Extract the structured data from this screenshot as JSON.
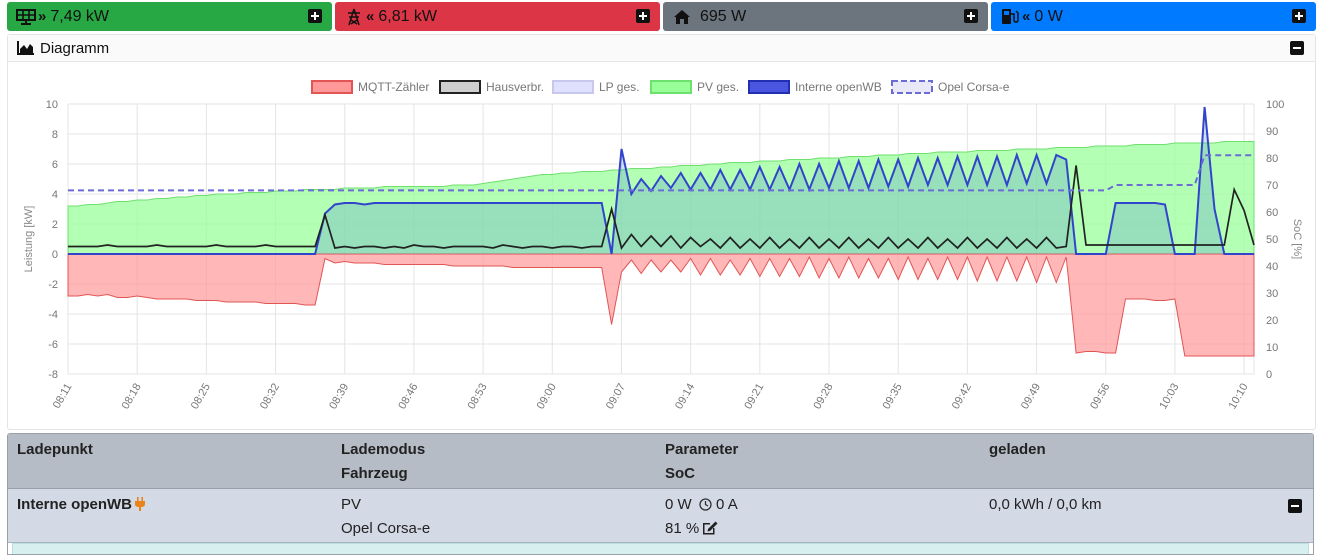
{
  "tiles": [
    {
      "name": "pv",
      "icon": "solar-panel-icon",
      "arrows": "»",
      "value": "7,49 kW",
      "color": "#28a745"
    },
    {
      "name": "grid",
      "icon": "power-pylon-icon",
      "arrows": "«",
      "value": "6,81 kW",
      "color": "#dc3545"
    },
    {
      "name": "house",
      "icon": "home-icon",
      "arrows": "",
      "value": "695 W",
      "color": "#6c757d"
    },
    {
      "name": "charging",
      "icon": "charging-station-icon",
      "arrows": "«",
      "value": "0 W",
      "color": "#007bff"
    }
  ],
  "diagram": {
    "title": "Diagramm"
  },
  "chart_data": {
    "type": "line",
    "legend": [
      "MQTT-Zähler",
      "Hausverbr.",
      "LP ges.",
      "PV ges.",
      "Interne openWB",
      "Opel Corsa-e"
    ],
    "legend_placement": "top",
    "ylabel": "Leistung [kW]",
    "y2label": "SoC [%]",
    "ylim": [
      -8,
      10
    ],
    "y2lim": [
      0,
      100
    ],
    "yticks": [
      -8,
      -6,
      -4,
      -2,
      0,
      2,
      4,
      6,
      8,
      10
    ],
    "y2ticks": [
      0,
      10,
      20,
      30,
      40,
      50,
      60,
      70,
      80,
      90,
      100
    ],
    "xticks": [
      "08:11",
      "08:18",
      "08:25",
      "08:32",
      "08:39",
      "08:46",
      "08:53",
      "09:00",
      "09:07",
      "09:14",
      "09:21",
      "09:28",
      "09:35",
      "09:42",
      "09:49",
      "09:56",
      "10:03",
      "10:10"
    ],
    "grid": true,
    "colors": {
      "grid": "#ff9999",
      "house": "#222222",
      "lp": "#e0e0ff",
      "pv": "#99ff99",
      "wb": "#3344cc",
      "soc": "#6b6bd6"
    },
    "x_minutes": [
      0,
      1,
      2,
      3,
      4,
      5,
      6,
      7,
      8,
      9,
      10,
      11,
      12,
      13,
      14,
      15,
      16,
      17,
      18,
      19,
      20,
      21,
      22,
      23,
      24,
      25,
      26,
      27,
      28,
      29,
      30,
      31,
      32,
      33,
      34,
      35,
      36,
      37,
      38,
      39,
      40,
      41,
      42,
      43,
      44,
      45,
      46,
      47,
      48,
      49,
      50,
      51,
      52,
      53,
      54,
      55,
      56,
      57,
      58,
      59,
      60,
      61,
      62,
      63,
      64,
      65,
      66,
      67,
      68,
      69,
      70,
      71,
      72,
      73,
      74,
      75,
      76,
      77,
      78,
      79,
      80,
      81,
      82,
      83,
      84,
      85,
      86,
      87,
      88,
      89,
      90,
      91,
      92,
      93,
      94,
      95,
      96,
      97,
      98,
      99,
      100,
      101,
      102,
      103,
      104,
      105,
      106,
      107,
      108,
      109,
      110,
      111,
      112,
      113,
      114,
      115,
      116,
      117,
      118,
      119,
      120
    ],
    "series": [
      {
        "name": "MQTT-Zähler",
        "values": [
          -2.8,
          -2.8,
          -2.7,
          -2.8,
          -2.7,
          -2.9,
          -2.9,
          -2.8,
          -2.9,
          -3.0,
          -3.0,
          -3.0,
          -3.0,
          -3.1,
          -3.1,
          -3.1,
          -3.2,
          -3.2,
          -3.2,
          -3.2,
          -3.3,
          -3.3,
          -3.3,
          -3.3,
          -3.4,
          -3.4,
          -0.3,
          -0.6,
          -0.5,
          -0.6,
          -0.6,
          -0.6,
          -0.7,
          -0.7,
          -0.7,
          -0.7,
          -0.7,
          -0.7,
          -0.7,
          -0.8,
          -0.8,
          -0.8,
          -0.8,
          -0.8,
          -0.8,
          -0.9,
          -0.9,
          -0.9,
          -0.9,
          -0.9,
          -0.9,
          -0.9,
          -0.9,
          -0.9,
          -0.9,
          -4.7,
          -1.2,
          -0.4,
          -1.3,
          -0.4,
          -1.2,
          -0.4,
          -1.2,
          -0.3,
          -1.4,
          -0.3,
          -1.4,
          -0.4,
          -1.4,
          -0.3,
          -1.5,
          -0.3,
          -1.5,
          -0.3,
          -1.5,
          -0.2,
          -1.6,
          -0.3,
          -1.6,
          -0.2,
          -1.6,
          -0.3,
          -1.6,
          -0.3,
          -1.7,
          -0.2,
          -1.7,
          -0.3,
          -1.7,
          -0.2,
          -1.7,
          -0.2,
          -1.8,
          -0.2,
          -1.8,
          -0.2,
          -1.8,
          -0.2,
          -1.9,
          -0.2,
          -1.9,
          -0.2,
          -6.6,
          -6.5,
          -6.5,
          -6.6,
          -6.6,
          -3.0,
          -3.0,
          -3.0,
          -3.1,
          -3.1,
          -3.0,
          -6.8,
          -6.8,
          -6.8,
          -6.8,
          -6.8,
          -6.8,
          -6.8,
          -6.8
        ]
      },
      {
        "name": "Hausverbr.",
        "values": [
          0.5,
          0.5,
          0.5,
          0.5,
          0.6,
          0.5,
          0.5,
          0.5,
          0.5,
          0.6,
          0.5,
          0.5,
          0.5,
          0.5,
          0.5,
          0.6,
          0.5,
          0.5,
          0.5,
          0.5,
          0.6,
          0.5,
          0.5,
          0.5,
          0.5,
          0.5,
          2.6,
          0.4,
          0.5,
          0.4,
          0.5,
          0.5,
          0.4,
          0.5,
          0.4,
          0.6,
          0.5,
          0.5,
          0.4,
          0.5,
          0.5,
          0.5,
          0.5,
          0.4,
          0.6,
          0.5,
          0.4,
          0.5,
          0.5,
          0.4,
          0.5,
          0.5,
          0.4,
          0.5,
          0.5,
          3.0,
          0.4,
          1.3,
          0.5,
          1.2,
          0.5,
          1.2,
          0.4,
          1.1,
          0.5,
          1.0,
          0.4,
          1.1,
          0.4,
          1.0,
          0.4,
          1.1,
          0.4,
          1.0,
          0.4,
          1.1,
          0.4,
          1.0,
          0.4,
          1.1,
          0.4,
          1.0,
          0.4,
          1.1,
          0.4,
          1.0,
          0.4,
          1.1,
          0.4,
          1.0,
          0.4,
          1.1,
          0.4,
          1.0,
          0.4,
          1.1,
          0.4,
          1.0,
          0.4,
          1.1,
          0.4,
          0.5,
          5.9,
          0.6,
          0.6,
          0.6,
          0.6,
          0.6,
          0.6,
          0.6,
          0.6,
          0.6,
          0.6,
          0.6,
          0.6,
          0.6,
          0.6,
          0.6,
          4.3,
          2.9,
          0.6,
          0.6
        ]
      },
      {
        "name": "LP ges.",
        "values": []
      },
      {
        "name": "PV ges.",
        "values": [
          3.2,
          3.2,
          3.3,
          3.3,
          3.4,
          3.5,
          3.5,
          3.6,
          3.6,
          3.7,
          3.7,
          3.8,
          3.8,
          3.9,
          3.9,
          4.0,
          4.0,
          4.0,
          4.1,
          4.1,
          4.1,
          4.2,
          4.2,
          4.2,
          4.3,
          4.3,
          4.3,
          4.3,
          4.4,
          4.4,
          4.4,
          4.4,
          4.5,
          4.5,
          4.5,
          4.5,
          4.5,
          4.5,
          4.5,
          4.6,
          4.6,
          4.6,
          4.7,
          4.8,
          4.9,
          5.0,
          5.1,
          5.2,
          5.3,
          5.3,
          5.4,
          5.4,
          5.5,
          5.5,
          5.5,
          5.6,
          5.6,
          5.7,
          5.7,
          5.7,
          5.8,
          5.8,
          5.9,
          5.9,
          5.9,
          6.0,
          6.0,
          6.1,
          6.1,
          6.1,
          6.2,
          6.2,
          6.2,
          6.3,
          6.3,
          6.3,
          6.4,
          6.4,
          6.4,
          6.5,
          6.5,
          6.5,
          6.6,
          6.6,
          6.6,
          6.7,
          6.7,
          6.7,
          6.8,
          6.8,
          6.8,
          6.8,
          6.9,
          6.9,
          6.9,
          6.9,
          7.0,
          7.0,
          7.0,
          7.0,
          7.1,
          7.1,
          7.1,
          7.1,
          7.2,
          7.2,
          7.2,
          7.2,
          7.3,
          7.3,
          7.3,
          7.3,
          7.4,
          7.4,
          7.4,
          7.4,
          7.4,
          7.5,
          7.5,
          7.5,
          7.5
        ]
      },
      {
        "name": "Interne openWB",
        "values": [
          0,
          0,
          0,
          0,
          0,
          0,
          0,
          0,
          0,
          0,
          0,
          0,
          0,
          0,
          0,
          0,
          0,
          0,
          0,
          0,
          0,
          0,
          0,
          0,
          0,
          0,
          2.7,
          3.3,
          3.4,
          3.4,
          3.3,
          3.4,
          3.4,
          3.4,
          3.4,
          3.4,
          3.4,
          3.4,
          3.4,
          3.4,
          3.4,
          3.4,
          3.4,
          3.4,
          3.4,
          3.4,
          3.4,
          3.4,
          3.4,
          3.4,
          3.4,
          3.4,
          3.4,
          3.4,
          3.4,
          0,
          7.0,
          4.0,
          5.0,
          4.2,
          5.2,
          4.4,
          5.4,
          4.3,
          5.4,
          4.3,
          5.6,
          4.3,
          5.6,
          4.3,
          5.8,
          4.3,
          5.8,
          4.3,
          6.0,
          4.3,
          6.0,
          4.4,
          6.2,
          4.4,
          6.2,
          4.4,
          6.3,
          4.5,
          6.3,
          4.5,
          6.4,
          4.6,
          6.4,
          4.6,
          6.5,
          4.6,
          6.5,
          4.6,
          6.5,
          4.6,
          6.6,
          4.7,
          6.6,
          4.7,
          6.6,
          6.3,
          0,
          0,
          0,
          0,
          3.4,
          3.4,
          3.4,
          3.4,
          3.4,
          3.3,
          0,
          0,
          0,
          9.8,
          3.0,
          0,
          0,
          0,
          0
        ]
      },
      {
        "name": "Opel Corsa-e",
        "values": [
          68,
          68,
          68,
          68,
          68,
          68,
          68,
          68,
          68,
          68,
          68,
          68,
          68,
          68,
          68,
          68,
          68,
          68,
          68,
          68,
          68,
          68,
          68,
          68,
          68,
          68,
          68,
          68,
          68,
          68,
          68,
          68,
          68,
          68,
          68,
          68,
          68,
          68,
          68,
          68,
          68,
          68,
          68,
          68,
          68,
          68,
          68,
          68,
          68,
          68,
          68,
          68,
          68,
          68,
          68,
          68,
          68,
          68,
          68,
          68,
          68,
          68,
          68,
          68,
          68,
          68,
          68,
          68,
          68,
          68,
          68,
          68,
          68,
          68,
          68,
          68,
          68,
          68,
          68,
          68,
          68,
          68,
          68,
          68,
          68,
          68,
          68,
          68,
          68,
          68,
          68,
          68,
          68,
          68,
          68,
          68,
          68,
          68,
          68,
          68,
          68,
          68,
          68,
          68,
          68,
          68,
          70,
          70,
          70,
          70,
          70,
          70,
          70,
          70,
          70,
          81,
          81,
          81,
          81,
          81,
          81
        ]
      }
    ]
  },
  "table": {
    "headers": {
      "ladepunkt": "Ladepunkt",
      "lademodus": "Lademodus",
      "fahrzeug": "Fahrzeug",
      "parameter": "Parameter",
      "soc": "SoC",
      "geladen": "geladen"
    },
    "rows": [
      {
        "name": "Interne openWB",
        "mode": "PV",
        "vehicle": "Opel Corsa-e",
        "power": "0 W",
        "current": "0 A",
        "soc": "81 %",
        "charged": "0,0 kWh / 0,0 km"
      }
    ]
  }
}
